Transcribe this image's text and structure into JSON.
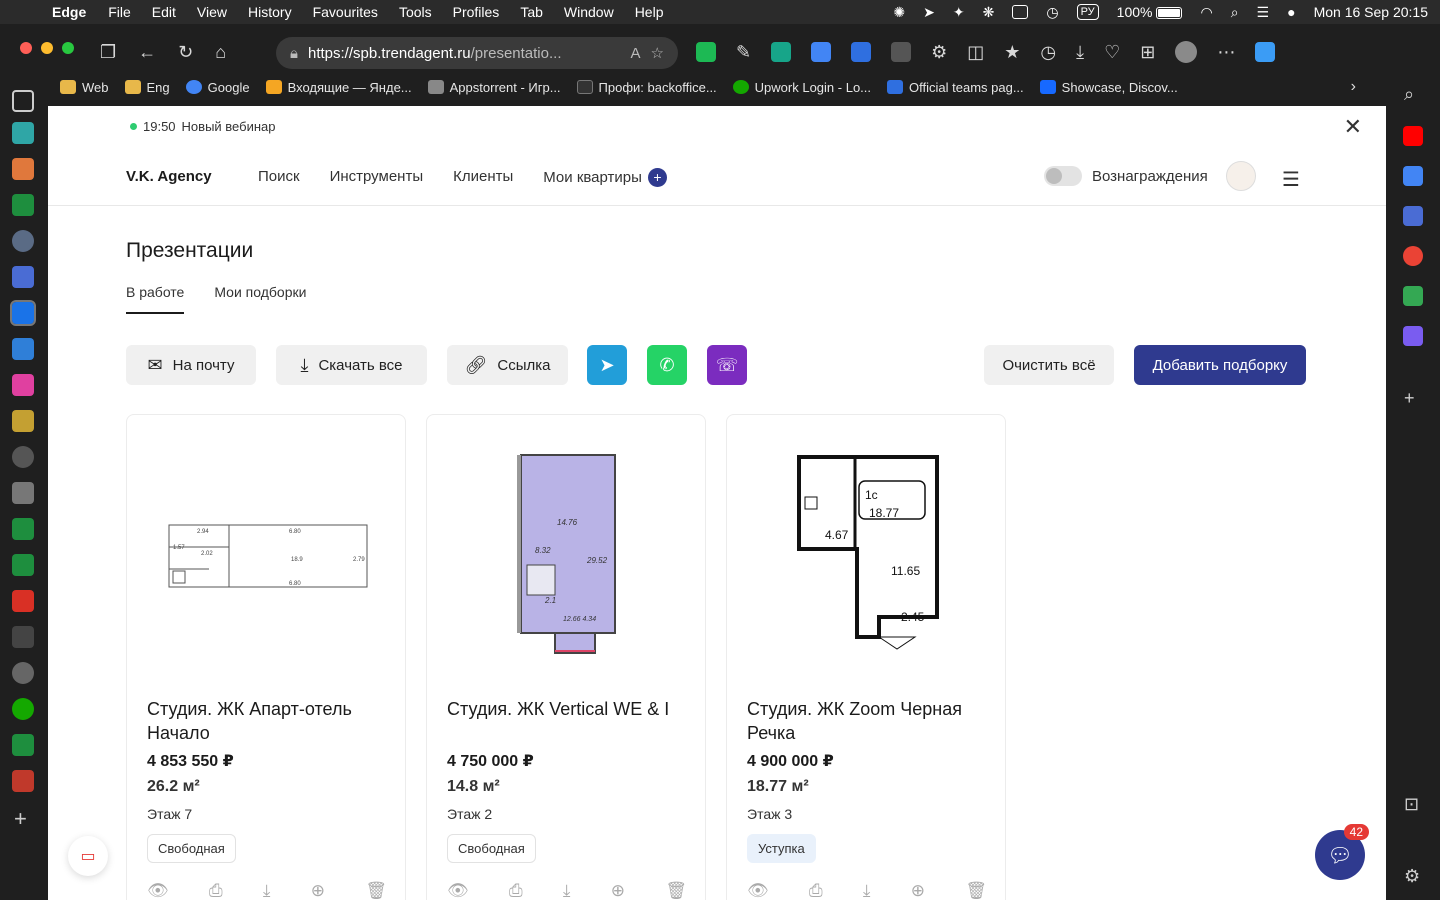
{
  "menubar": {
    "app_name": "Edge",
    "items": [
      "File",
      "Edit",
      "View",
      "History",
      "Favourites",
      "Tools",
      "Profiles",
      "Tab",
      "Window",
      "Help"
    ],
    "keyboard_layout": "РУ",
    "battery": "100%",
    "datetime": "Mon 16 Sep  20:15"
  },
  "browser": {
    "url_host": "https://spb.trendagent.ru",
    "url_path": "/presentatio...",
    "bookmarks": [
      {
        "label": "Web",
        "color": "#e8b84a"
      },
      {
        "label": "Eng",
        "color": "#e8b84a"
      },
      {
        "label": "Google",
        "color": "#4285f4"
      },
      {
        "label": "Входящие — Янде...",
        "color": "#f5a623"
      },
      {
        "label": "Appstorrent - Игр...",
        "color": "#888888"
      },
      {
        "label": "Профи: backoffice...",
        "color": "#333333"
      },
      {
        "label": "Upwork Login - Lo...",
        "color": "#14a800"
      },
      {
        "label": "Official teams pag...",
        "color": "#2f6fe0"
      },
      {
        "label": "Showcase, Discov...",
        "color": "#1769ff"
      }
    ]
  },
  "site": {
    "webinar_time": "19:50",
    "webinar_label": "Новый вебинар",
    "logo": "V.K. Agency",
    "nav": [
      "Поиск",
      "Инструменты",
      "Клиенты",
      "Мои квартиры"
    ],
    "nav_plus": "+",
    "rewards_label": "Вознаграждения"
  },
  "page": {
    "title": "Презентации",
    "tabs": [
      "В работе",
      "Мои подборки"
    ],
    "buttons": {
      "mail": "На почту",
      "download_all": "Скачать все",
      "link": "Ссылка",
      "clear_all": "Очистить всё",
      "add_collection": "Добавить подборку"
    },
    "social_colors": {
      "telegram": "#229ed9",
      "whatsapp": "#25d366",
      "viber": "#7b2cbf"
    }
  },
  "cards": [
    {
      "title": "Студия. ЖК Апарт-отель Начало",
      "price": "4 853 550 ₽",
      "area": "26.2 м²",
      "floor": "Этаж 7",
      "status": "Свободная",
      "plan_labels": [
        "2.94",
        "6.80",
        "1.57",
        "2.02",
        "18.9",
        "2.79",
        "6.80"
      ]
    },
    {
      "title": "Студия. ЖК Vertical WE & I",
      "price": "4 750 000 ₽",
      "area": "14.8 м²",
      "floor": "Этаж 2",
      "status": "Свободная",
      "plan_labels": [
        "14.76",
        "8.32",
        "29.52",
        "2.1",
        "12.66 4.34"
      ]
    },
    {
      "title": "Студия. ЖК Zoom Черная Речка",
      "price": "4 900 000 ₽",
      "area": "18.77 м²",
      "floor": "Этаж 3",
      "status": "Уступка",
      "plan_labels": [
        "1с",
        "18.77",
        "4.67",
        "11.65",
        "2.45"
      ]
    }
  ],
  "chat": {
    "unread": "42"
  }
}
